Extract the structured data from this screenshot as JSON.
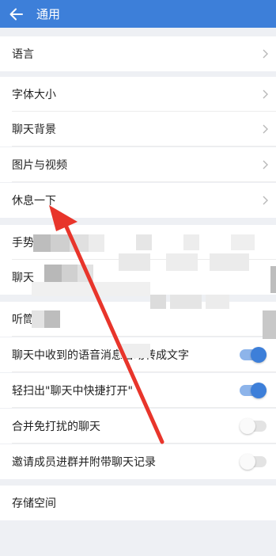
{
  "header": {
    "title": "通用"
  },
  "rows": {
    "language": "语言",
    "font_size": "字体大小",
    "chat_background": "聊天背景",
    "photos_videos": "图片与视频",
    "take_break": "休息一下",
    "gesture": "手势",
    "chat": "聊天",
    "earpiece": "听筒",
    "voice_to_text": "聊天中收到的语音消息自动转成文字",
    "swipe_open": "轻扫出\"聊天中快捷打开\"",
    "merge_muted": "合并免打扰的聊天",
    "invite_history": "邀请成员进群并附带聊天记录",
    "storage": "存储空间"
  },
  "toggles": {
    "voice_to_text": true,
    "swipe_open": true,
    "merge_muted": false,
    "invite_history": false
  },
  "colors": {
    "accent": "#3d7fd9",
    "annotation_arrow": "#e8352b"
  }
}
